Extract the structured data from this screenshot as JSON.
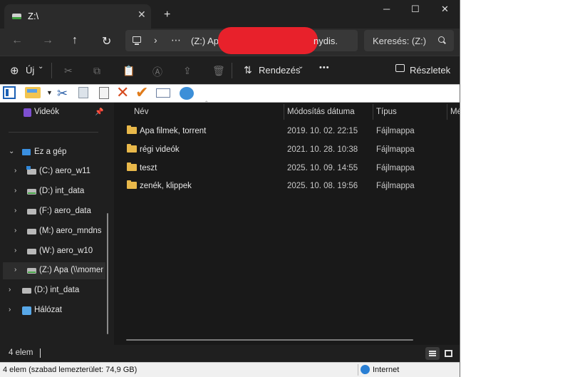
{
  "tab": {
    "title": "Z:\\",
    "close": "✕",
    "new": "+"
  },
  "window_controls": {
    "minimize": "─",
    "maximize": "☐",
    "close": "✕"
  },
  "nav": {
    "back": "←",
    "forward": "→",
    "up": "↑",
    "refresh": "↻"
  },
  "address": {
    "chev": "›",
    "more": "⋯",
    "path": "(Z:) Apa",
    "path_tail": "nydis."
  },
  "search": {
    "placeholder": "Keresés: (Z:)"
  },
  "command_bar": {
    "new_label": "Új",
    "new_chevron": "⌄",
    "sort_label": "Rendezés",
    "sort_chevron": "⌄",
    "more": "•••",
    "details_label": "Részletek",
    "icons": {
      "cut": "✂",
      "copy": "⧉",
      "paste": "📋",
      "rename": "Ⓐ",
      "share": "⇪",
      "delete": "🗑"
    }
  },
  "sidebar": {
    "quick": {
      "label": "Videók",
      "pin": "📌"
    },
    "this_pc": "Ez a gép",
    "drives": [
      {
        "label": "(C:) aero_w11"
      },
      {
        "label": "(D:) int_data"
      },
      {
        "label": "(F:) aero_data"
      },
      {
        "label": "(M:) aero_mndns"
      },
      {
        "label": "(W:) aero_w10"
      },
      {
        "label": "(Z:) Apa (\\\\momen"
      }
    ],
    "top_drive": "(D:) int_data",
    "network": "Hálózat",
    "chevron_open": "⌄",
    "chevron_closed": "›"
  },
  "columns": {
    "name": "Név",
    "modified": "Módosítás dátuma",
    "type": "Típus",
    "size": "Mé",
    "sort": "⌃"
  },
  "files": [
    {
      "name": "Apa filmek, torrent",
      "date": "2019. 10. 02. 22:15",
      "type": "Fájlmappa"
    },
    {
      "name": "régi videók",
      "date": "2021. 10. 28. 10:38",
      "type": "Fájlmappa"
    },
    {
      "name": "teszt",
      "date": "2025. 10. 09. 14:55",
      "type": "Fájlmappa"
    },
    {
      "name": "zenék, klippek",
      "date": "2025. 10. 08. 19:56",
      "type": "Fájlmappa"
    }
  ],
  "status": {
    "count": "4 elem"
  },
  "classic_status": {
    "free": "4 elem (szabad lemezterület: 74,9 GB)",
    "zone": "Internet"
  }
}
